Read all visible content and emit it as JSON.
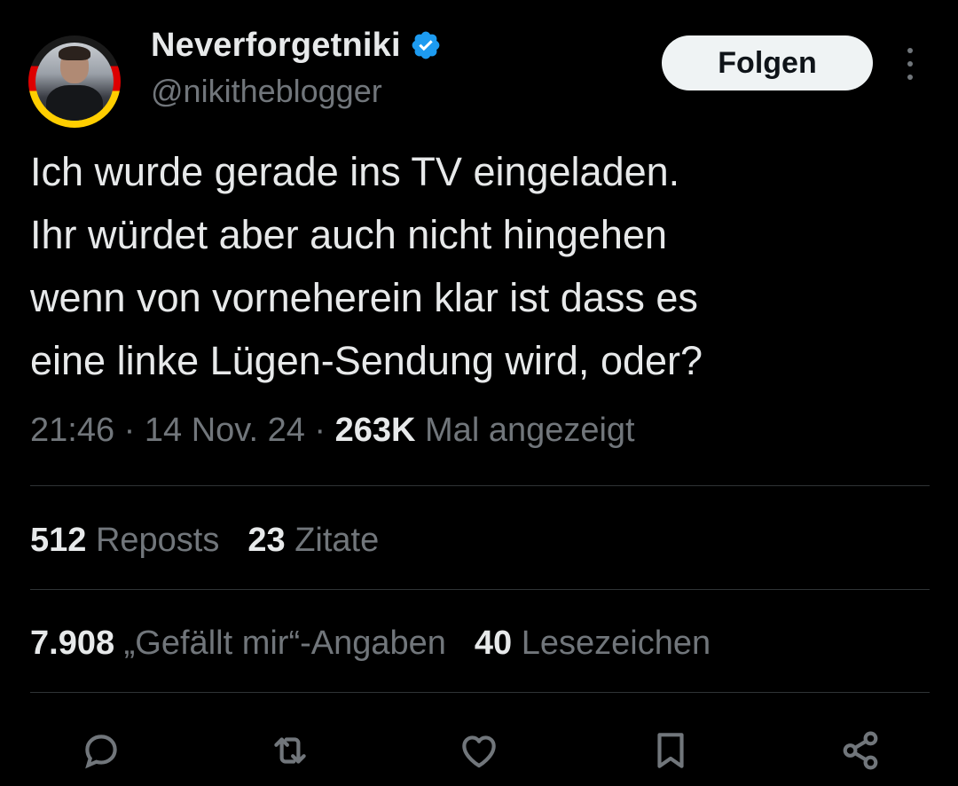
{
  "author": {
    "display_name": "Neverforgetniki",
    "handle": "@nikitheblogger",
    "verified_badge_color": "#1d9bf0"
  },
  "header": {
    "follow_label": "Folgen",
    "more_icon": "more-vertical-icon"
  },
  "tweet": {
    "lines": [
      "Ich wurde gerade ins TV eingeladen.",
      "Ihr würdet aber auch nicht hingehen",
      "wenn von vorneherein klar ist dass es",
      "eine linke Lügen-Sendung wird, oder?"
    ]
  },
  "meta": {
    "time": "21:46",
    "sep1": " · ",
    "date": "14 Nov. 24",
    "sep2": " · ",
    "views": "263K",
    "views_label": " Mal angezeigt"
  },
  "stats": {
    "reposts_count": "512",
    "reposts_label": " Reposts",
    "quotes_count": "23",
    "quotes_label": " Zitate",
    "likes_count": "7.908",
    "likes_label": " „Gefällt mir“-Angaben",
    "bookmarks_count": "40",
    "bookmarks_label": " Lesezeichen"
  },
  "actions": [
    "reply-icon",
    "repost-icon",
    "like-icon",
    "bookmark-icon",
    "share-icon"
  ],
  "colors": {
    "background": "#000000",
    "text_primary": "#e7e9ea",
    "text_secondary": "#71767b",
    "divider": "#2f3336",
    "follow_button_bg": "#eff3f4"
  }
}
